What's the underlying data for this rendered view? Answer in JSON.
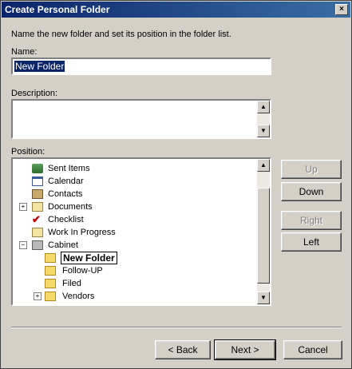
{
  "dialog": {
    "title": "Create Personal Folder",
    "close_symbol": "×",
    "instruction": "Name the new folder and set its position in the folder list."
  },
  "name_field": {
    "label": "Name:",
    "value": "New Folder"
  },
  "description_field": {
    "label": "Description:",
    "value": ""
  },
  "position": {
    "label": "Position:",
    "items": [
      {
        "label": "Sent Items",
        "icon": "sent-items-icon"
      },
      {
        "label": "Calendar",
        "icon": "calendar-icon"
      },
      {
        "label": "Contacts",
        "icon": "contacts-icon"
      },
      {
        "label": "Documents",
        "icon": "documents-icon",
        "expander": "+"
      },
      {
        "label": "Checklist",
        "icon": "checklist-icon"
      },
      {
        "label": "Work In Progress",
        "icon": "work-in-progress-icon"
      },
      {
        "label": "Cabinet",
        "icon": "cabinet-icon",
        "expander": "−"
      },
      {
        "label": "New Folder",
        "icon": "folder-icon",
        "selected": true
      },
      {
        "label": "Follow-UP",
        "icon": "folder-icon"
      },
      {
        "label": "Filed",
        "icon": "folder-icon"
      },
      {
        "label": "Vendors",
        "icon": "folder-icon",
        "expander": "+"
      }
    ]
  },
  "side_buttons": {
    "up": "Up",
    "down": "Down",
    "right": "Right",
    "left": "Left"
  },
  "footer_buttons": {
    "back": "< Back",
    "next": "Next >",
    "cancel": "Cancel"
  },
  "colors": {
    "title_bar": "#0a246a",
    "selection": "#0a246a",
    "face": "#d4d0c8"
  }
}
